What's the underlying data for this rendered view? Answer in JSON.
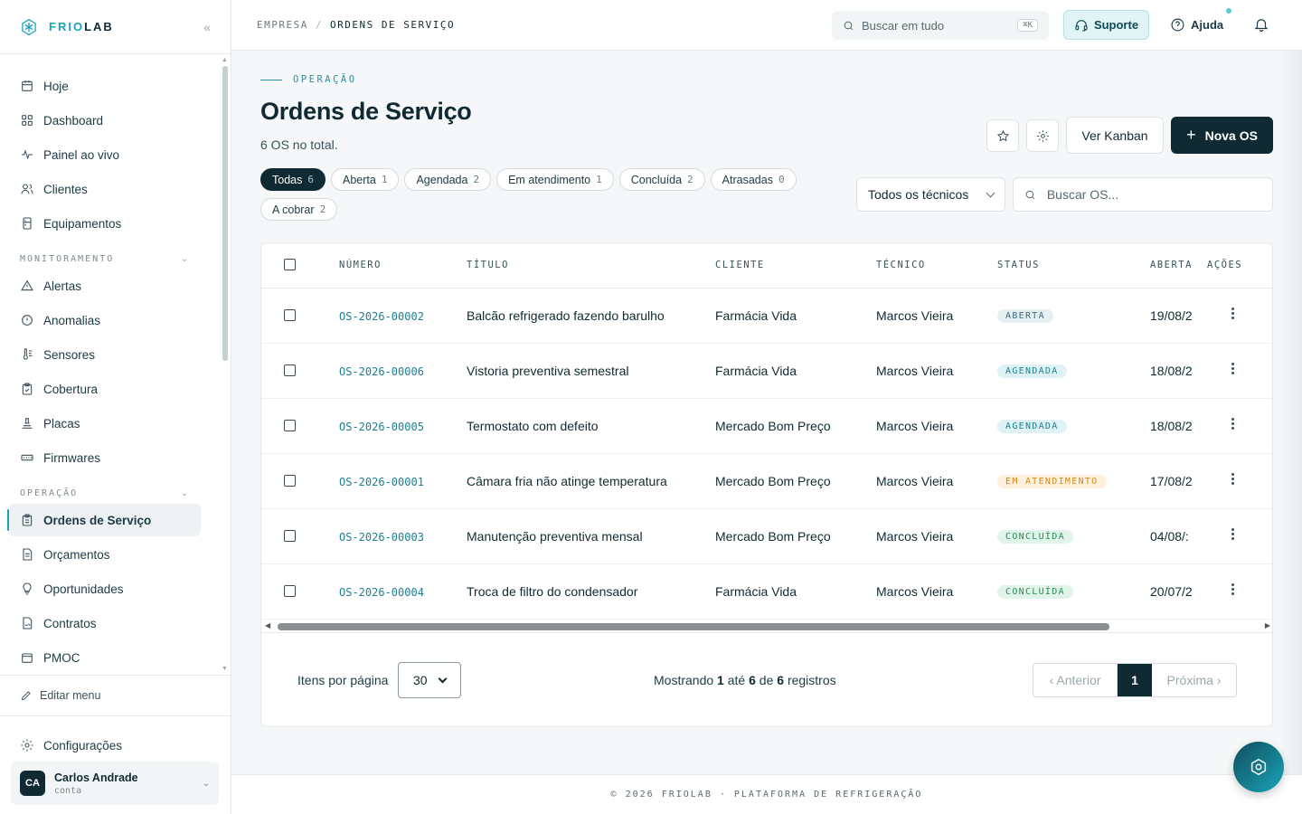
{
  "brand": {
    "name_part1": "FRIO",
    "name_part2": "LAB",
    "collapse": "«"
  },
  "sidebar": {
    "items_top": [
      {
        "label": "Hoje",
        "icon": "calendar-icon"
      },
      {
        "label": "Dashboard",
        "icon": "dashboard-icon"
      },
      {
        "label": "Painel ao vivo",
        "icon": "pulse-icon"
      },
      {
        "label": "Clientes",
        "icon": "users-icon"
      },
      {
        "label": "Equipamentos",
        "icon": "fridge-icon"
      }
    ],
    "section_monitoramento": "MONITORAMENTO",
    "items_monitoramento": [
      {
        "label": "Alertas",
        "icon": "alert-icon"
      },
      {
        "label": "Anomalias",
        "icon": "anomaly-icon"
      },
      {
        "label": "Sensores",
        "icon": "sensor-icon"
      },
      {
        "label": "Cobertura",
        "icon": "clipboard-check-icon"
      },
      {
        "label": "Placas",
        "icon": "board-icon"
      },
      {
        "label": "Firmwares",
        "icon": "chip-icon"
      }
    ],
    "section_operacao": "OPERAÇÃO",
    "items_operacao": [
      {
        "label": "Ordens de Serviço",
        "icon": "clipboard-icon",
        "active": true
      },
      {
        "label": "Orçamentos",
        "icon": "document-icon"
      },
      {
        "label": "Oportunidades",
        "icon": "lightbulb-icon"
      },
      {
        "label": "Contratos",
        "icon": "contract-icon"
      },
      {
        "label": "PMOC",
        "icon": "pmoc-icon"
      }
    ],
    "edit_menu": "Editar menu",
    "config": "Configurações",
    "user": {
      "initials": "CA",
      "name": "Carlos Andrade",
      "role": "conta"
    }
  },
  "topbar": {
    "breadcrumb_root": "EMPRESA",
    "breadcrumb_sep": "/",
    "breadcrumb_current": "ORDENS DE SERVIÇO",
    "search_placeholder": "Buscar em tudo",
    "search_kbd": "⌘K",
    "support": "Suporte",
    "help": "Ajuda"
  },
  "page": {
    "eyebrow": "OPERAÇÃO",
    "title": "Ordens de Serviço",
    "subtitle": "6 OS no total.",
    "btn_kanban": "Ver Kanban",
    "btn_new_plus": "+",
    "btn_new": "Nova OS"
  },
  "filters": {
    "chips": [
      {
        "label": "Todas",
        "count": "6",
        "active": true
      },
      {
        "label": "Aberta",
        "count": "1"
      },
      {
        "label": "Agendada",
        "count": "2"
      },
      {
        "label": "Em atendimento",
        "count": "1"
      },
      {
        "label": "Concluída",
        "count": "2"
      },
      {
        "label": "Atrasadas",
        "count": "0"
      },
      {
        "label": "A cobrar",
        "count": "2"
      }
    ],
    "technician_select": "Todos os técnicos",
    "search_placeholder": "Buscar OS..."
  },
  "table": {
    "headers": {
      "number": "NÚMERO",
      "title": "TÍTULO",
      "client": "CLIENTE",
      "technician": "TÉCNICO",
      "status": "STATUS",
      "opened": "ABERTA",
      "actions": "AÇÕES"
    },
    "rows": [
      {
        "number": "OS-2026-00002",
        "title": "Balcão refrigerado fazendo barulho",
        "client": "Farmácia Vida",
        "technician": "Marcos Vieira",
        "status": "ABERTA",
        "status_kind": "aberta",
        "opened": "19/08/2"
      },
      {
        "number": "OS-2026-00006",
        "title": "Vistoria preventiva semestral",
        "client": "Farmácia Vida",
        "technician": "Marcos Vieira",
        "status": "AGENDADA",
        "status_kind": "agendada",
        "opened": "18/08/2"
      },
      {
        "number": "OS-2026-00005",
        "title": "Termostato com defeito",
        "client": "Mercado Bom Preço",
        "technician": "Marcos Vieira",
        "status": "AGENDADA",
        "status_kind": "agendada",
        "opened": "18/08/2"
      },
      {
        "number": "OS-2026-00001",
        "title": "Câmara fria não atinge temperatura",
        "client": "Mercado Bom Preço",
        "technician": "Marcos Vieira",
        "status": "EM ATENDIMENTO",
        "status_kind": "atendimento",
        "opened": "17/08/2"
      },
      {
        "number": "OS-2026-00003",
        "title": "Manutenção preventiva mensal",
        "client": "Mercado Bom Preço",
        "technician": "Marcos Vieira",
        "status": "CONCLUÍDA",
        "status_kind": "concluida",
        "opened": "04/08/:"
      },
      {
        "number": "OS-2026-00004",
        "title": "Troca de filtro do condensador",
        "client": "Farmácia Vida",
        "technician": "Marcos Vieira",
        "status": "CONCLUÍDA",
        "status_kind": "concluida",
        "opened": "20/07/2"
      }
    ],
    "status_colors": {
      "aberta": {
        "bg": "#e6f0f3",
        "fg": "#3c6a78"
      },
      "agendada": {
        "bg": "#dff2f5",
        "fg": "#1d7f8f"
      },
      "atendimento": {
        "bg": "#fdf0dc",
        "fg": "#d38a1e"
      },
      "concluida": {
        "bg": "#e1f4ea",
        "fg": "#2e8a57"
      }
    }
  },
  "pagination": {
    "per_page_label": "Itens por página",
    "per_page_value": "30",
    "showing_prefix": "Mostrando",
    "showing_from": "1",
    "showing_mid1": "até",
    "showing_to": "6",
    "showing_mid2": "de",
    "showing_total": "6",
    "showing_suffix": "registros",
    "prev": "‹ Anterior",
    "page": "1",
    "next": "Próxima ›"
  },
  "footer": {
    "text": "© 2026 FRIOLAB · PLATAFORMA DE REFRIGERAÇÃO"
  }
}
